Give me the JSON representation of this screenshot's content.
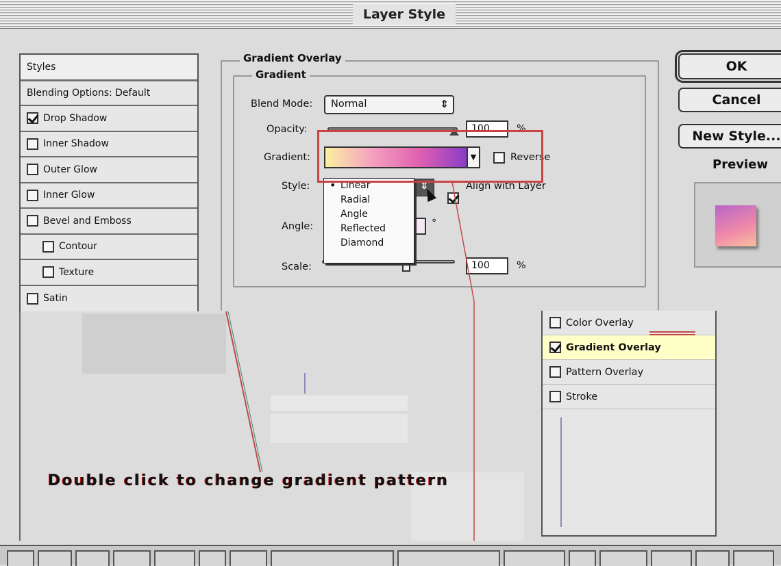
{
  "window": {
    "title": "Layer Style"
  },
  "styles_panel": {
    "header": "Styles",
    "blending": "Blending Options: Default",
    "items": [
      {
        "label": "Drop Shadow",
        "checked": true,
        "indent": false
      },
      {
        "label": "Inner Shadow",
        "checked": false,
        "indent": false
      },
      {
        "label": "Outer Glow",
        "checked": false,
        "indent": false
      },
      {
        "label": "Inner Glow",
        "checked": false,
        "indent": false
      },
      {
        "label": "Bevel and Emboss",
        "checked": false,
        "indent": false
      },
      {
        "label": "Contour",
        "checked": false,
        "indent": true
      },
      {
        "label": "Texture",
        "checked": false,
        "indent": true
      },
      {
        "label": "Satin",
        "checked": false,
        "indent": false
      }
    ]
  },
  "gradient_overlay": {
    "section_title": "Gradient Overlay",
    "subsection_title": "Gradient",
    "blend_mode_label": "Blend Mode:",
    "blend_mode_value": "Normal",
    "opacity_label": "Opacity:",
    "opacity_value": "100",
    "opacity_unit": "%",
    "gradient_label": "Gradient:",
    "reverse_label": "Reverse",
    "reverse_checked": false,
    "style_label": "Style:",
    "align_label": "Align with Layer",
    "align_checked": true,
    "angle_label": "Angle:",
    "angle_unit": "°",
    "scale_label": "Scale:",
    "scale_value": "100",
    "scale_unit": "%",
    "style_options": [
      "Linear",
      "Radial",
      "Angle",
      "Reflected",
      "Diamond"
    ],
    "style_selected": "Linear",
    "gradient_colors": [
      "#fbf0a0",
      "#f5a0c0",
      "#e060b0",
      "#8a3cc8"
    ]
  },
  "buttons": {
    "ok": "OK",
    "cancel": "Cancel",
    "new_style": "New Style...",
    "preview_label": "Preview",
    "preview_checked": true
  },
  "inset_panel": {
    "items": [
      {
        "label": "Color Overlay",
        "checked": false,
        "highlight": false
      },
      {
        "label": "Gradient Overlay",
        "checked": true,
        "highlight": true
      },
      {
        "label": "Pattern Overlay",
        "checked": false,
        "highlight": false
      },
      {
        "label": "Stroke",
        "checked": false,
        "highlight": false
      }
    ]
  },
  "caption": "Double click to change gradient pattern",
  "colors": {
    "highlight_border": "#c94343",
    "annotation_line": "#c24848"
  }
}
